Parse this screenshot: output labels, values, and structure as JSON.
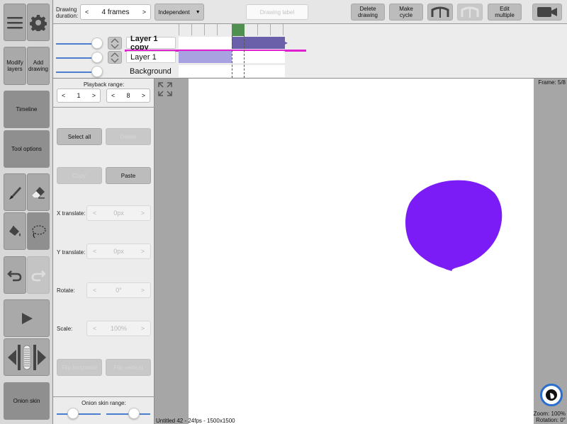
{
  "toolbar": {
    "drawing_duration_label": "Drawing duration:",
    "duration_value": "4 frames",
    "prev_arrow": "<",
    "next_arrow": ">",
    "mode_select": "Independent",
    "drawing_label_placeholder": "Drawing label",
    "delete_drawing": "Delete drawing",
    "make_cycle": "Make cycle",
    "edit_multiple": "Edit multiple"
  },
  "layers": [
    {
      "name": "Layer 1 copy",
      "selected": true
    },
    {
      "name": "Layer 1",
      "selected": false
    },
    {
      "name": "Background",
      "selected": false
    }
  ],
  "left_toolbar": {
    "modify_layers": "Modify layers",
    "add_drawing": "Add drawing",
    "timeline": "Timeline",
    "tool_options": "Tool options",
    "onion_skin": "Onion skin"
  },
  "panel": {
    "playback_range_label": "Playback range:",
    "range_start": "1",
    "range_end": "8",
    "select_all": "Select all",
    "delete": "Delete",
    "copy": "Copy",
    "paste": "Paste",
    "x_translate_label": "X translate:",
    "x_translate_value": "0px",
    "y_translate_label": "Y translate:",
    "y_translate_value": "0px",
    "rotate_label": "Rotate:",
    "rotate_value": "0°",
    "scale_label": "Scale:",
    "scale_value": "100%",
    "flip_horizontal": "Flip horizontal",
    "flip_vertical": "Flip vertical",
    "onion_skin_range_label": "Onion skin range:"
  },
  "status": {
    "file_info": "Untitled 42 - 24fps - 1500x1500",
    "frame": "Frame: 5/8",
    "zoom": "Zoom: 100%",
    "rotation": "Rotation: 0°"
  },
  "colors": {
    "blob": "#7b1cf6",
    "selected_layer_underline": "#e020d0",
    "frame_selected": "#6a60aa",
    "frame_prev": "#a8a2e0",
    "playhead": "#4f8f4f"
  }
}
